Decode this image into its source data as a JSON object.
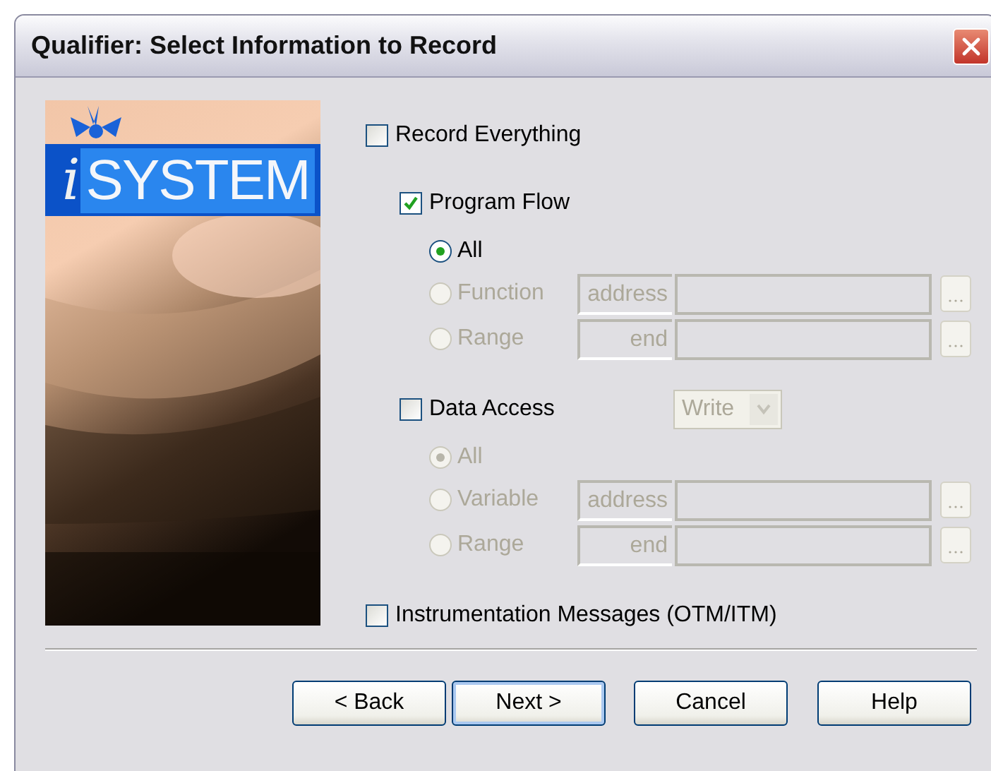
{
  "window": {
    "title": "Qualifier: Select Information to Record"
  },
  "logo": {
    "letter": "i",
    "name": "SYSTEM"
  },
  "options": [
    {
      "kind": "checkbox",
      "label": "Record Everything",
      "checked": false
    },
    {
      "kind": "group",
      "label": "Program Flow",
      "checked": true,
      "choices": [
        {
          "label": "All",
          "selected": true,
          "disabled": false
        },
        {
          "label": "Function",
          "selected": false,
          "disabled": true,
          "field_label": "address"
        },
        {
          "label": "Range",
          "selected": false,
          "disabled": true,
          "field_label": "end"
        }
      ]
    },
    {
      "kind": "group",
      "label": "Data Access",
      "checked": false,
      "mode": {
        "value": "Write",
        "disabled": true
      },
      "choices": [
        {
          "label": "All",
          "selected": true,
          "disabled": true
        },
        {
          "label": "Variable",
          "selected": false,
          "disabled": true,
          "field_label": "address"
        },
        {
          "label": "Range",
          "selected": false,
          "disabled": true,
          "field_label": "end"
        }
      ]
    },
    {
      "kind": "checkbox",
      "label": "Instrumentation Messages (OTM/ITM)",
      "checked": false
    }
  ],
  "buttons": [
    {
      "label": "< Back",
      "default": false
    },
    {
      "label": "Next >",
      "default": true
    },
    {
      "label": "Cancel",
      "default": false
    },
    {
      "label": "Help",
      "default": false
    }
  ]
}
